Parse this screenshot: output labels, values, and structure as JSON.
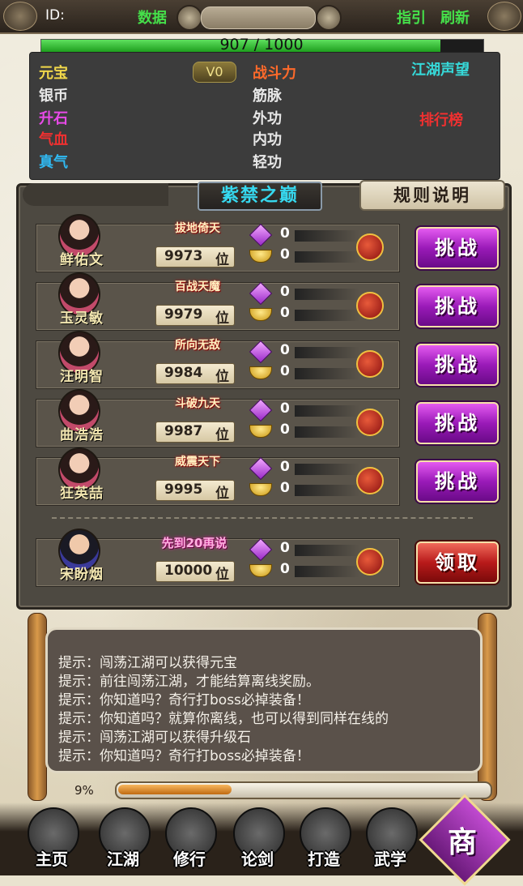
{
  "header": {
    "id_label": "ID:",
    "data_label": "数据",
    "guide_label": "指引",
    "refresh_label": "刷新"
  },
  "hp": {
    "text": "907 / 1000",
    "current": 907,
    "max": 1000
  },
  "stats": {
    "left": [
      {
        "label": "元宝",
        "color": "#f0d74a"
      },
      {
        "label": "银币",
        "color": "#e8e8e8"
      },
      {
        "label": "升石",
        "color": "#e84ae8"
      },
      {
        "label": "气血",
        "color": "#f03030"
      },
      {
        "label": "真气",
        "color": "#30b8f0"
      }
    ],
    "vip": "V0",
    "middle": [
      {
        "label": "战斗力",
        "color": "#ff6a2a"
      },
      {
        "label": "筋脉",
        "color": "#e8e8e8"
      },
      {
        "label": "外功",
        "color": "#e8e8e8"
      },
      {
        "label": "内功",
        "color": "#e8e8e8"
      },
      {
        "label": "轻功",
        "color": "#e8e8e8"
      }
    ],
    "reputation": "江湖声望",
    "leaderboard": "排行榜"
  },
  "panel": {
    "title": "紫禁之巅",
    "rules": "规则说明"
  },
  "rankings": [
    {
      "name": "鲜佑文",
      "title": "拔地倚天",
      "rank": "9973",
      "rank_unit": "位",
      "gems": "0",
      "gold": "0",
      "button": "挑战"
    },
    {
      "name": "玉灵敏",
      "title": "百战天魔",
      "rank": "9979",
      "rank_unit": "位",
      "gems": "0",
      "gold": "0",
      "button": "挑战"
    },
    {
      "name": "汪明智",
      "title": "所向无敌",
      "rank": "9984",
      "rank_unit": "位",
      "gems": "0",
      "gold": "0",
      "button": "挑战"
    },
    {
      "name": "曲浩浩",
      "title": "斗破九天",
      "rank": "9987",
      "rank_unit": "位",
      "gems": "0",
      "gold": "0",
      "button": "挑战"
    },
    {
      "name": "狂英喆",
      "title": "威震天下",
      "rank": "9995",
      "rank_unit": "位",
      "gems": "0",
      "gold": "0",
      "button": "挑战"
    }
  ],
  "self": {
    "name": "宋盼烟",
    "title": "先到20再说",
    "rank": "10000",
    "rank_unit": "位",
    "gems": "0",
    "gold": "0",
    "button": "领取"
  },
  "hints": [
    "提示：闯荡江湖可以获得元宝",
    "提示：前往闯荡江湖，才能结算离线奖励。",
    "提示：你知道吗？奇行打boss必掉装备！",
    "提示：你知道吗？就算你离线，也可以得到同样在线的",
    "提示：闯荡江湖可以获得升级石",
    "提示：你知道吗？奇行打boss必掉装备！"
  ],
  "exp": {
    "text": "9%",
    "fraction": 0.09
  },
  "nav": [
    {
      "label": "主页",
      "icon": "home-icon"
    },
    {
      "label": "江湖",
      "icon": "jianghu-icon"
    },
    {
      "label": "修行",
      "icon": "door-icon"
    },
    {
      "label": "论剑",
      "icon": "sword-icon"
    },
    {
      "label": "打造",
      "icon": "hammer-icon"
    },
    {
      "label": "武学",
      "icon": "book-icon"
    }
  ],
  "shop": "商"
}
